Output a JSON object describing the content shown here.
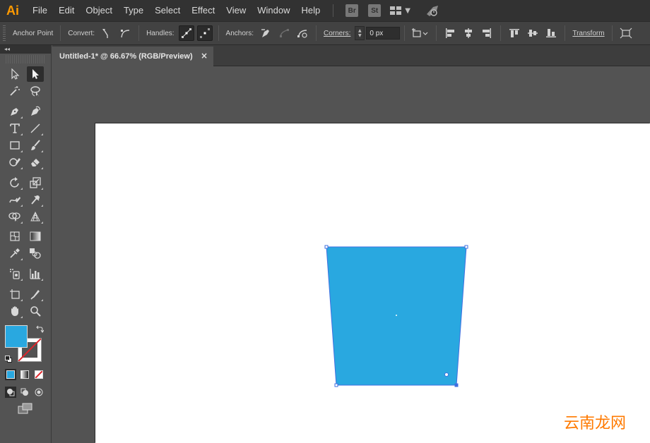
{
  "app": {
    "logo": "Ai",
    "bridge_label": "Br",
    "stock_label": "St"
  },
  "menu": [
    "File",
    "Edit",
    "Object",
    "Type",
    "Select",
    "Effect",
    "View",
    "Window",
    "Help"
  ],
  "control_bar": {
    "anchor_point_label": "Anchor Point",
    "convert_label": "Convert:",
    "handles_label": "Handles:",
    "anchors_label": "Anchors:",
    "corners_label": "Corners:",
    "corners_value": "0 px",
    "transform_label": "Transform"
  },
  "panel": {
    "collapse_label": "◂◂"
  },
  "document": {
    "tab_title": "Untitled-1* @ 66.67% (RGB/Preview)",
    "close_glyph": "×"
  },
  "colors": {
    "fill": "#29a8e0",
    "accent": "#2b86c5",
    "shape_selection": "#3f6fe0"
  },
  "watermark": "云南龙网",
  "icons": [
    "selection-tool-icon",
    "direct-selection-tool-icon",
    "magic-wand-icon",
    "lasso-icon",
    "pen-icon",
    "curvature-icon",
    "type-icon",
    "line-segment-icon",
    "rectangle-icon",
    "paintbrush-icon",
    "shaper-icon",
    "eraser-icon",
    "rotate-icon",
    "scale-icon",
    "warp-icon",
    "puppet-warp-icon",
    "shape-builder-icon",
    "perspective-grid-icon",
    "mesh-icon",
    "gradient-icon",
    "eyedropper-icon",
    "blend-icon",
    "symbol-sprayer-icon",
    "column-graph-icon",
    "artboard-icon",
    "slice-icon",
    "hand-icon",
    "zoom-icon"
  ]
}
